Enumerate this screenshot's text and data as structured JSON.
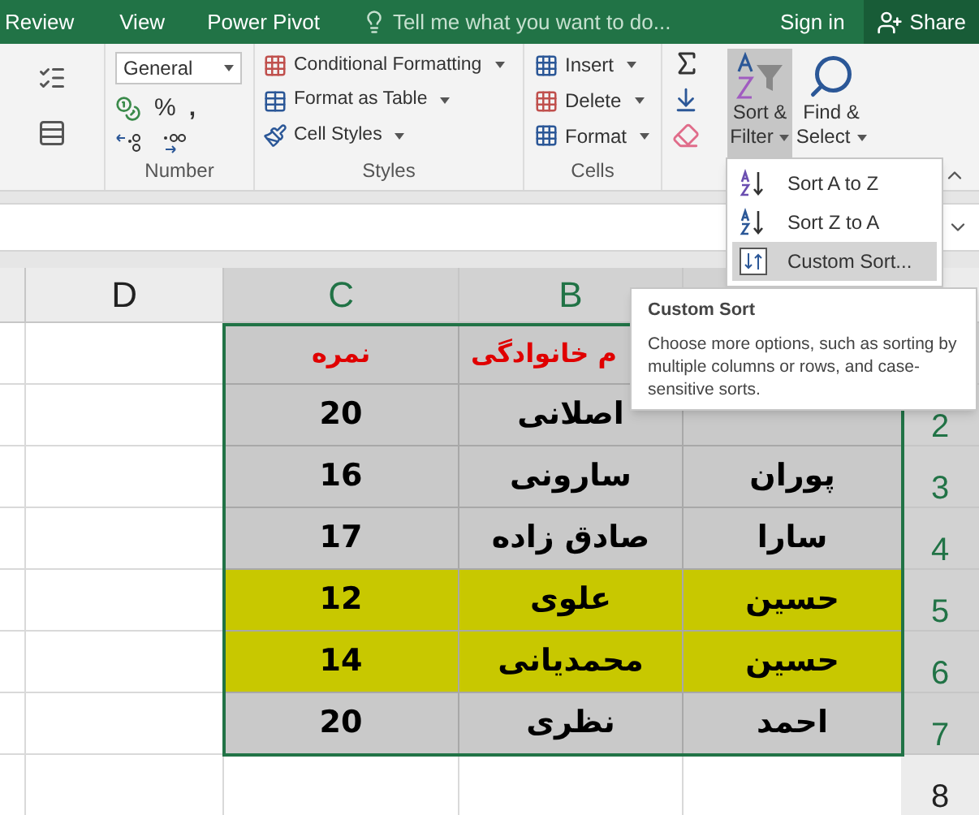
{
  "ribbon_tabs": {
    "review": {
      "label": "Review"
    },
    "view": {
      "label": "View"
    },
    "power_pivot": {
      "label": "Power Pivot"
    }
  },
  "tell_me": {
    "placeholder": "Tell me what you want to do..."
  },
  "account": {
    "sign_in": "Sign in",
    "share": "Share"
  },
  "number_group": {
    "format": "General",
    "percent": "%",
    "comma": ",",
    "label": "Number"
  },
  "styles_group": {
    "items": [
      "Conditional Formatting",
      "Format as Table",
      "Cell Styles"
    ],
    "label": "Styles"
  },
  "cells_group": {
    "items": [
      "Insert",
      "Delete",
      "Format"
    ],
    "label": "Cells"
  },
  "editing_group": {
    "sort_filter": {
      "line_1": "Sort &",
      "line_2": "Filter",
      "expanded": true
    },
    "find_select": {
      "line_1": "Find &",
      "line_2": "Select"
    }
  },
  "sort_menu": [
    {
      "kind": "az",
      "label": "Sort A to Z",
      "selected": false
    },
    {
      "kind": "za",
      "label": "Sort Z to A",
      "selected": false
    },
    {
      "kind": "custom",
      "label": "Custom Sort...",
      "selected": true
    }
  ],
  "tooltip": {
    "title": "Custom Sort",
    "text": "Choose more options, such as sorting by multiple columns or rows, and case-sensitive sorts."
  },
  "columns": [
    {
      "label": "B",
      "selected": true
    },
    {
      "label": "C",
      "selected": true
    },
    {
      "label": "D",
      "selected": false
    }
  ],
  "rows": [
    {
      "kind": "header",
      "highlight": false,
      "cells": [
        "",
        "م خانوادگی",
        "نمره"
      ]
    },
    {
      "kind": "data",
      "number": "2",
      "highlight": false,
      "cells": [
        "",
        "اصلانی",
        "20"
      ]
    },
    {
      "kind": "data",
      "number": "3",
      "highlight": false,
      "cells": [
        "پوران",
        "سارونی",
        "16"
      ]
    },
    {
      "kind": "data",
      "number": "4",
      "highlight": false,
      "cells": [
        "سارا",
        "صادق زاده",
        "17"
      ]
    },
    {
      "kind": "data",
      "number": "5",
      "highlight": true,
      "cells": [
        "حسین",
        "علوی",
        "12"
      ]
    },
    {
      "kind": "data",
      "number": "6",
      "highlight": true,
      "cells": [
        "حسین",
        "محمدیانی",
        "14"
      ]
    },
    {
      "kind": "data",
      "number": "7",
      "highlight": false,
      "cells": [
        "احمد",
        "نظری",
        "20"
      ]
    },
    {
      "kind": "empty",
      "number": "8",
      "cells": []
    }
  ]
}
